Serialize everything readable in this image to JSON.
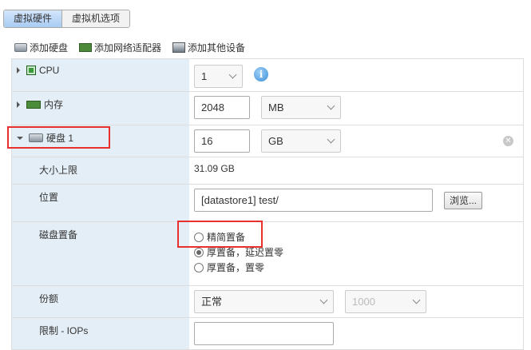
{
  "tabs": [
    {
      "label": "虚拟硬件",
      "active": true
    },
    {
      "label": "虚拟机选项",
      "active": false
    }
  ],
  "toolbar": {
    "add_disk": "添加硬盘",
    "add_network": "添加网络适配器",
    "add_other": "添加其他设备"
  },
  "cpu": {
    "label": "CPU",
    "value": "1"
  },
  "memory": {
    "label": "内存",
    "value": "2048",
    "unit": "MB"
  },
  "disk": {
    "label": "硬盘 1",
    "value": "16",
    "unit": "GB",
    "max_size_label": "大小上限",
    "max_size": "31.09 GB",
    "location_label": "位置",
    "location": "[datastore1] test/",
    "browse": "浏览...",
    "provisioning_label": "磁盘置备",
    "provisioning_options": [
      {
        "label": "精简置备",
        "selected": false
      },
      {
        "label": "厚置备，延迟置零",
        "selected": true
      },
      {
        "label": "厚置备，置零",
        "selected": false
      }
    ],
    "shares_label": "份额",
    "shares": "正常",
    "shares_value": "1000",
    "limit_label": "限制 - IOPs"
  },
  "colors": {
    "highlight": "#e8312c",
    "label_bg": "#e4eef6"
  }
}
